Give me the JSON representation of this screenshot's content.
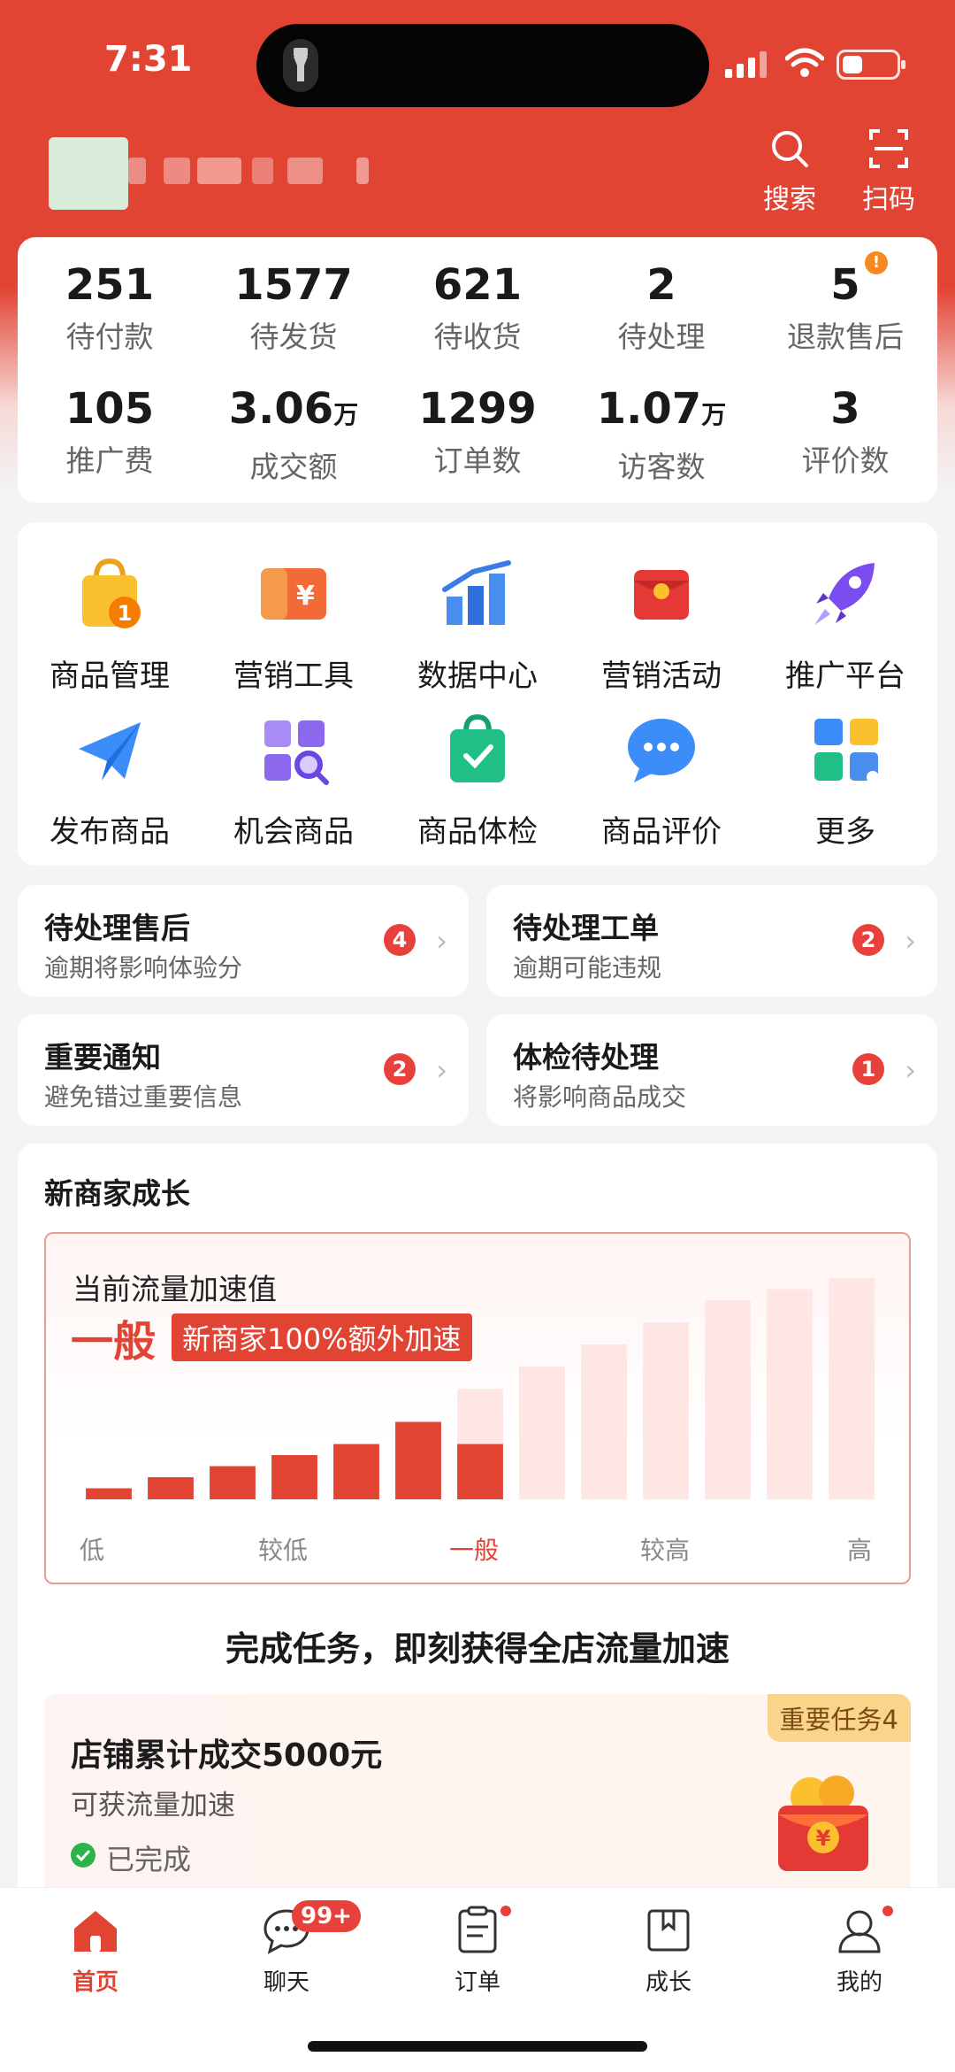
{
  "status_bar": {
    "time": "7:31"
  },
  "header": {
    "search_label": "搜索",
    "scan_label": "扫码"
  },
  "stats": [
    {
      "value": "251",
      "label": "待付款"
    },
    {
      "value": "1577",
      "label": "待发货"
    },
    {
      "value": "621",
      "label": "待收货"
    },
    {
      "value": "2",
      "label": "待处理"
    },
    {
      "value": "5",
      "label": "退款售后",
      "badge": "!"
    },
    {
      "value": "105",
      "label": "推广费"
    },
    {
      "value": "3.06",
      "unit": "万",
      "label": "成交额"
    },
    {
      "value": "1299",
      "label": "订单数"
    },
    {
      "value": "1.07",
      "unit": "万",
      "label": "访客数"
    },
    {
      "value": "3",
      "label": "评价数"
    }
  ],
  "menu": [
    {
      "label": "商品管理",
      "icon": "shopping-bag-icon",
      "badge": "1"
    },
    {
      "label": "营销工具",
      "icon": "coupon-icon"
    },
    {
      "label": "数据中心",
      "icon": "bar-chart-icon"
    },
    {
      "label": "营销活动",
      "icon": "red-envelope-icon"
    },
    {
      "label": "推广平台",
      "icon": "rocket-icon"
    },
    {
      "label": "发布商品",
      "icon": "paper-plane-icon"
    },
    {
      "label": "机会商品",
      "icon": "grid-search-icon"
    },
    {
      "label": "商品体检",
      "icon": "check-bag-icon"
    },
    {
      "label": "商品评价",
      "icon": "chat-bubble-icon"
    },
    {
      "label": "更多",
      "icon": "more-apps-icon"
    }
  ],
  "tasks": [
    {
      "title": "待处理售后",
      "sub": "逾期将影响体验分",
      "count": "4"
    },
    {
      "title": "待处理工单",
      "sub": "逾期可能违规",
      "count": "2"
    },
    {
      "title": "重要通知",
      "sub": "避免错过重要信息",
      "count": "2"
    },
    {
      "title": "体检待处理",
      "sub": "将影响商品成交",
      "count": "1"
    }
  ],
  "growth": {
    "title": "新商家成长",
    "chart_title": "当前流量加速值",
    "current_level": "一般",
    "boost_tag": "新商家100%额外加速",
    "task_heading": "完成任务，即刻获得全店流量加速",
    "mission": {
      "title": "店铺累计成交5000元",
      "sub": "可获流量加速",
      "status": "已完成",
      "tag": "重要任务4"
    }
  },
  "chart_data": {
    "type": "bar",
    "title": "当前流量加速值",
    "categories": [
      "1",
      "2",
      "3",
      "4",
      "5",
      "6",
      "7",
      "8",
      "9",
      "10",
      "11",
      "12",
      "13"
    ],
    "values": [
      8,
      16,
      24,
      32,
      40,
      56,
      40,
      0,
      0,
      0,
      0,
      0,
      0
    ],
    "background_values": [
      8,
      16,
      24,
      32,
      40,
      56,
      80,
      96,
      112,
      128,
      144,
      152,
      160
    ],
    "tick_labels": [
      "低",
      "较低",
      "一般",
      "较高",
      "高"
    ],
    "current_tick": "一般",
    "colors": {
      "active": "#e24434",
      "inactive": "#fde6e4"
    }
  },
  "tabbar": [
    {
      "label": "首页",
      "icon": "home-icon",
      "active": true
    },
    {
      "label": "聊天",
      "icon": "chat-icon",
      "badge": "99+"
    },
    {
      "label": "订单",
      "icon": "order-icon",
      "dot": true
    },
    {
      "label": "成长",
      "icon": "book-icon"
    },
    {
      "label": "我的",
      "icon": "profile-icon",
      "dot": true
    }
  ],
  "colors": {
    "brand": "#e24434",
    "badge": "#e8403a",
    "gold": "#fbd48b"
  }
}
